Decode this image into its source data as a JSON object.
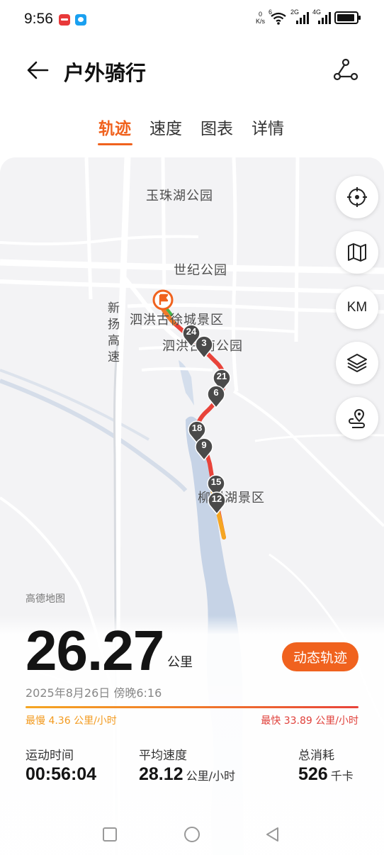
{
  "status_bar": {
    "time": "9:56",
    "net_speed_value": "0",
    "net_speed_unit": "K/s",
    "wifi_tag": "6",
    "sim1_tag": "2G",
    "sim2_tag": "4G"
  },
  "header": {
    "title": "户外骑行"
  },
  "tabs": [
    {
      "label": "轨迹",
      "active": true
    },
    {
      "label": "速度",
      "active": false
    },
    {
      "label": "图表",
      "active": false
    },
    {
      "label": "详情",
      "active": false
    }
  ],
  "map": {
    "labels": {
      "yuzhu_park": "玉珠湖公园",
      "century_park": "世纪公园",
      "xucheng": "泗洪古徐城景区",
      "park2": "泗洪古南公园",
      "liushu": "柳树湖景区",
      "highway": "新扬高速",
      "provider": "高德地图"
    },
    "controls": [
      {
        "name": "locate-button",
        "icon": "locate-icon"
      },
      {
        "name": "map-type-button",
        "icon": "map-icon"
      },
      {
        "name": "km-markers-button",
        "label": "KM"
      },
      {
        "name": "layers-button",
        "icon": "layers-icon"
      },
      {
        "name": "route-button",
        "icon": "route-pin-icon"
      }
    ],
    "km_markers": [
      "24",
      "3",
      "21",
      "6",
      "18",
      "9",
      "15",
      "12"
    ]
  },
  "stats": {
    "distance": "26.27",
    "distance_unit": "公里",
    "replay_label": "动态轨迹",
    "datetime": "2025年8月26日 傍晚6:16",
    "slowest": "最慢 4.36 公里/小时",
    "fastest": "最快 33.89 公里/小时",
    "duration_label": "运动时间",
    "duration_value": "00:56:04",
    "avg_speed_label": "平均速度",
    "avg_speed_value": "28.12",
    "avg_speed_unit": "公里/小时",
    "calories_label": "总消耗",
    "calories_value": "526",
    "calories_unit": "千卡"
  },
  "colors": {
    "accent": "#f0621e",
    "route_slow": "#f5a623",
    "route_fast": "#e8433a"
  }
}
